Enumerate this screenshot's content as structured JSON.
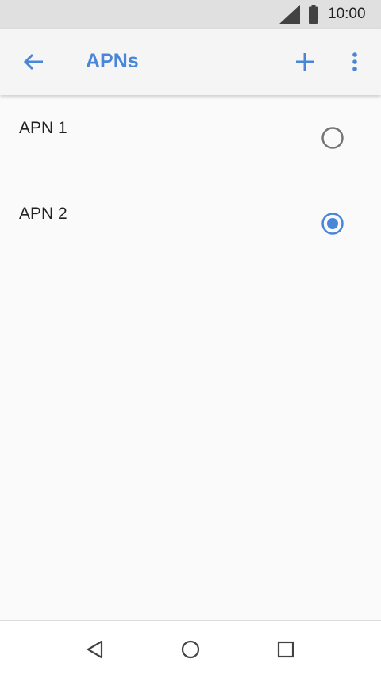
{
  "status_bar": {
    "time": "10:00",
    "signal_icon": "cellular-signal-icon",
    "battery_icon": "battery-icon"
  },
  "app_bar": {
    "title": "APNs",
    "back_icon": "arrow-back-icon",
    "add_icon": "plus-icon",
    "more_icon": "more-vert-icon"
  },
  "apn_list": [
    {
      "name": "APN 1",
      "selected": false
    },
    {
      "name": "APN 2",
      "selected": true
    }
  ],
  "nav_bar": {
    "back_icon": "triangle-back-icon",
    "home_icon": "circle-home-icon",
    "recents_icon": "square-recents-icon"
  },
  "colors": {
    "accent": "#4a86d8",
    "status_bar_bg": "#e0e0e0",
    "app_bar_bg": "#f5f5f5",
    "page_bg": "#fafafa",
    "unselected_radio": "#757575"
  }
}
